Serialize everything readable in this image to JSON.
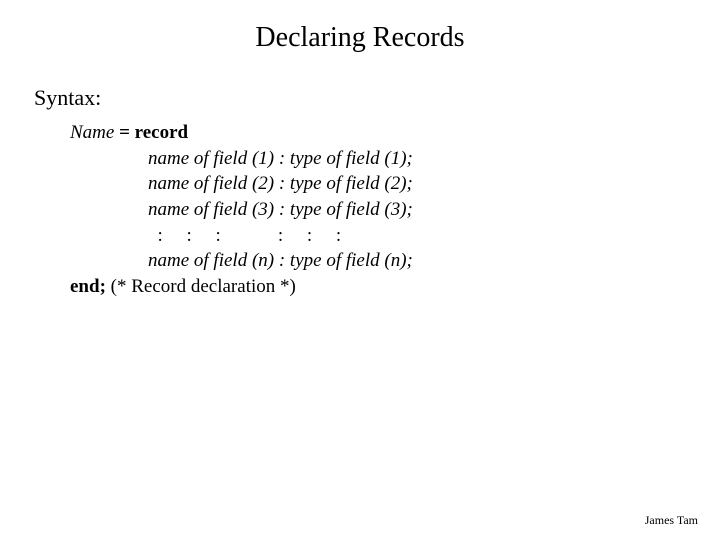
{
  "title": "Declaring Records",
  "syntax_label": "Syntax:",
  "decl": {
    "name_word": "Name",
    "equals_record": " = record",
    "field1": "name of field (1) : type of field (1);",
    "field2": "name of field (2) : type of field (2);",
    "field3": "name of field (3) : type of field (3);",
    "dots": "  :     :     :            :     :     :",
    "fieldn": "name of field (n) : type of field (n);",
    "end_kw": "end;",
    "end_comment": " (* Record declaration *)"
  },
  "footer": "James Tam"
}
